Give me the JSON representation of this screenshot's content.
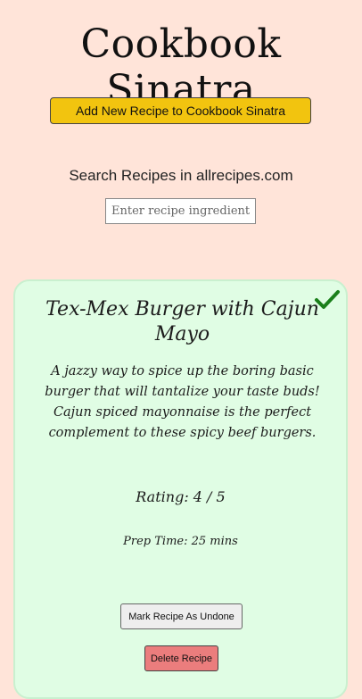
{
  "header": {
    "title": "Cookbook Sinatra",
    "add_button_label": "Add New Recipe to Cookbook Sinatra"
  },
  "search": {
    "label": "Search Recipes in allrecipes.com",
    "placeholder": "Enter recipe ingredient",
    "value": ""
  },
  "recipe": {
    "title": "Tex-Mex Burger with Cajun Mayo",
    "description": "A jazzy way to spice up the boring basic burger that will tantalize your taste buds! Cajun spiced mayonnaise is the perfect complement to these spicy beef burgers.",
    "rating_text": "Rating: 4 / 5",
    "prep_time_text": "Prep Time: 25 mins",
    "done_icon": "checkmark-icon",
    "undone_button_label": "Mark Recipe As Undone",
    "delete_button_label": "Delete Recipe"
  },
  "colors": {
    "page_background": "#ffe4d9",
    "add_button": "#f2c40f",
    "card_background": "#e0fde4",
    "checkmark": "#1a7f1a",
    "delete_button": "#eb7d7d"
  }
}
